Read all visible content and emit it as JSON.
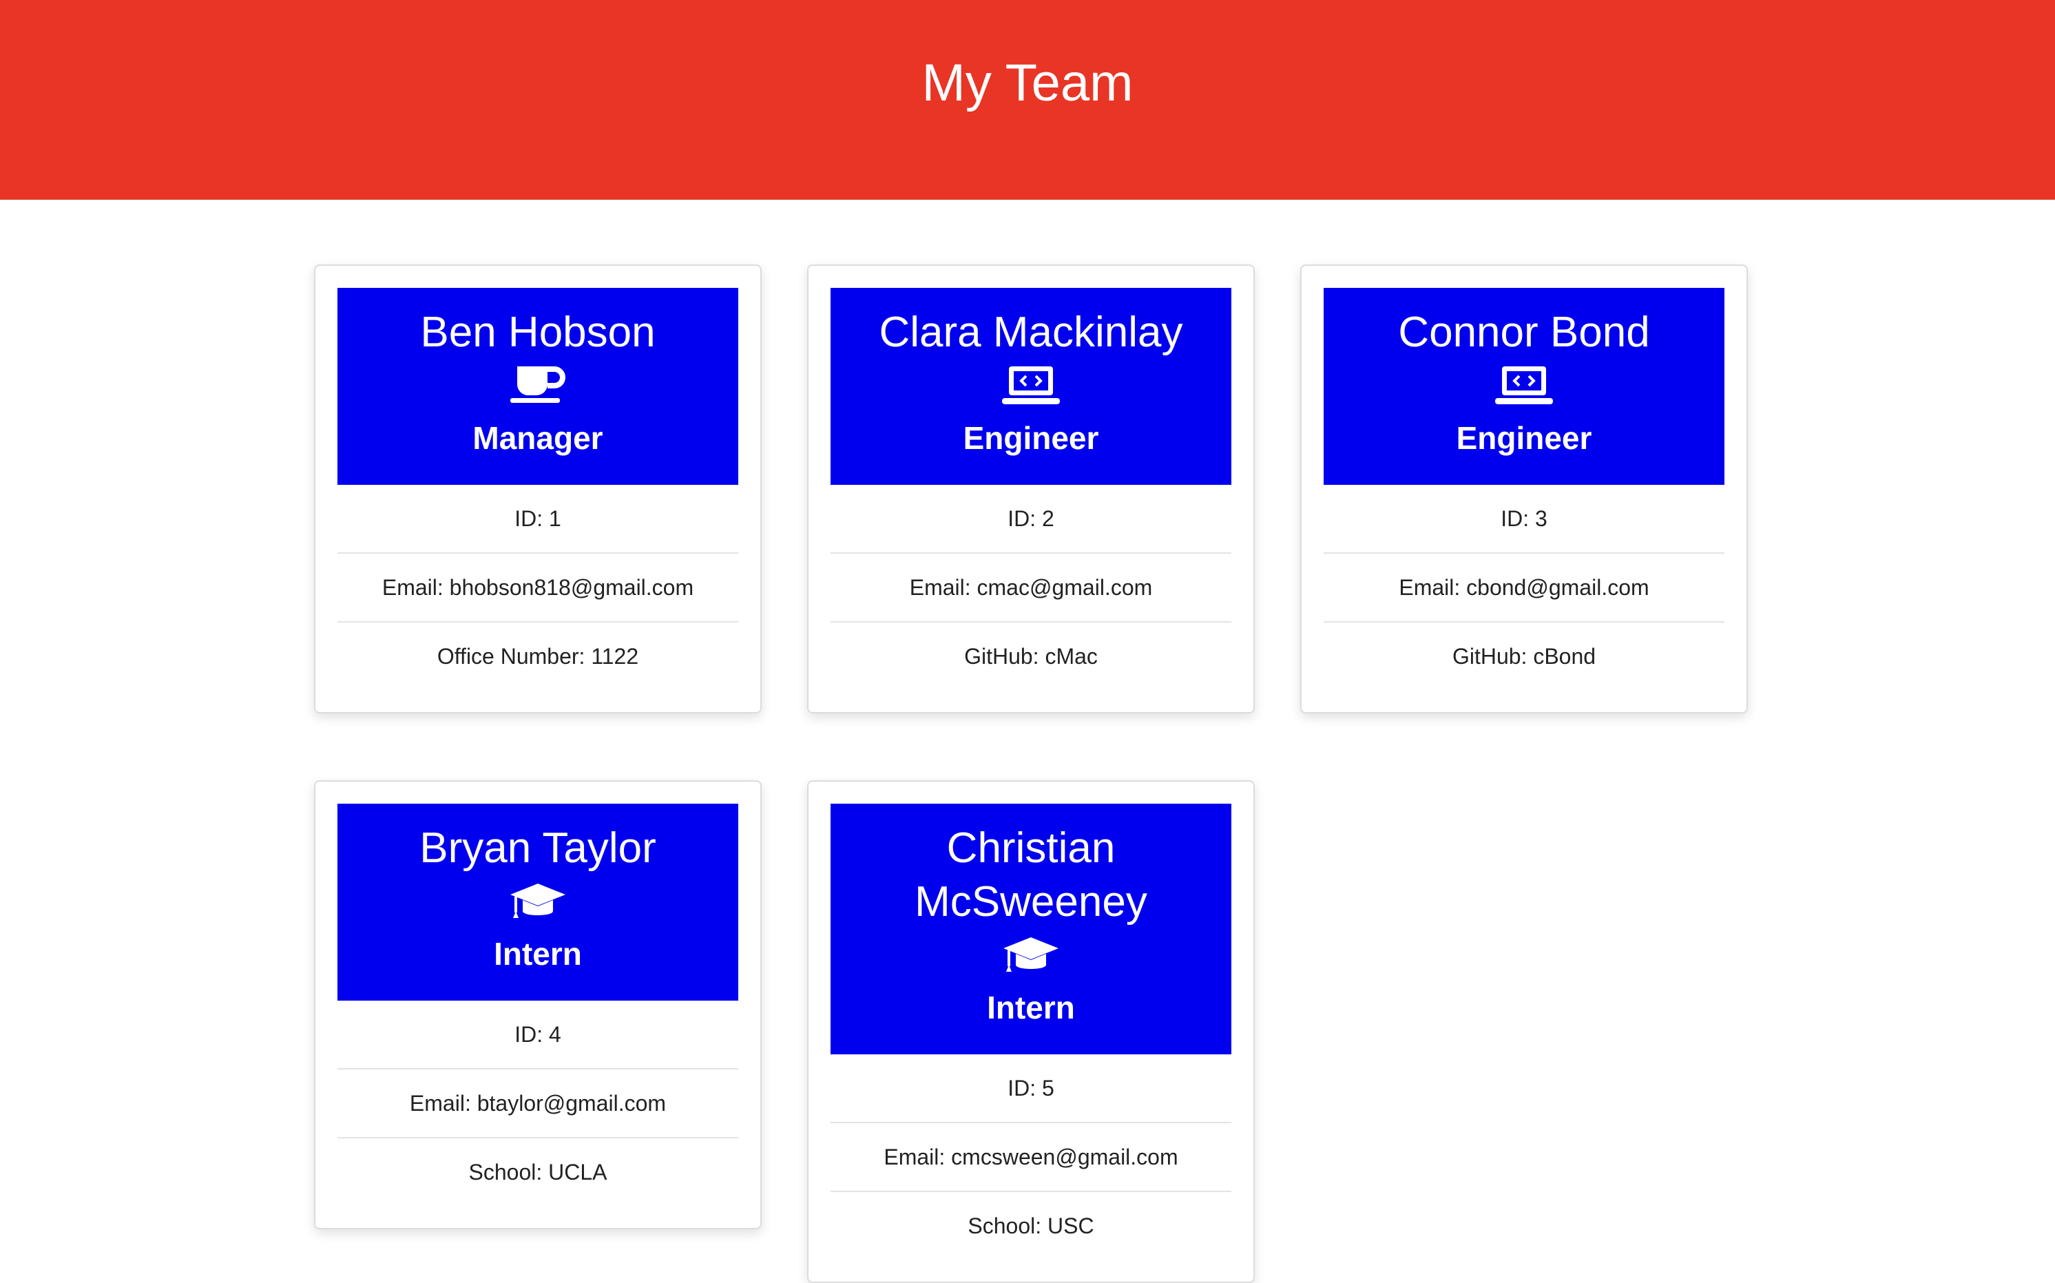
{
  "header": {
    "title": "My Team"
  },
  "team": [
    {
      "name": "Ben Hobson",
      "icon": "coffee-mug-icon",
      "role": "Manager",
      "details": [
        "ID: 1",
        "Email: bhobson818@gmail.com",
        "Office Number: 1122"
      ]
    },
    {
      "name": "Clara Mackinlay",
      "icon": "laptop-code-icon",
      "role": "Engineer",
      "details": [
        "ID: 2",
        "Email: cmac@gmail.com",
        "GitHub: cMac"
      ]
    },
    {
      "name": "Connor Bond",
      "icon": "laptop-code-icon",
      "role": "Engineer",
      "details": [
        "ID: 3",
        "Email: cbond@gmail.com",
        "GitHub: cBond"
      ]
    },
    {
      "name": "Bryan Taylor",
      "icon": "graduation-cap-icon",
      "role": "Intern",
      "details": [
        "ID: 4",
        "Email: btaylor@gmail.com",
        "School: UCLA"
      ]
    },
    {
      "name": "Christian McSweeney",
      "icon": "graduation-cap-icon",
      "role": "Intern",
      "details": [
        "ID: 5",
        "Email: cmcsween@gmail.com",
        "School: USC"
      ]
    }
  ],
  "colors": {
    "header_bg": "#e83525",
    "card_head_bg": "#0000ef"
  }
}
